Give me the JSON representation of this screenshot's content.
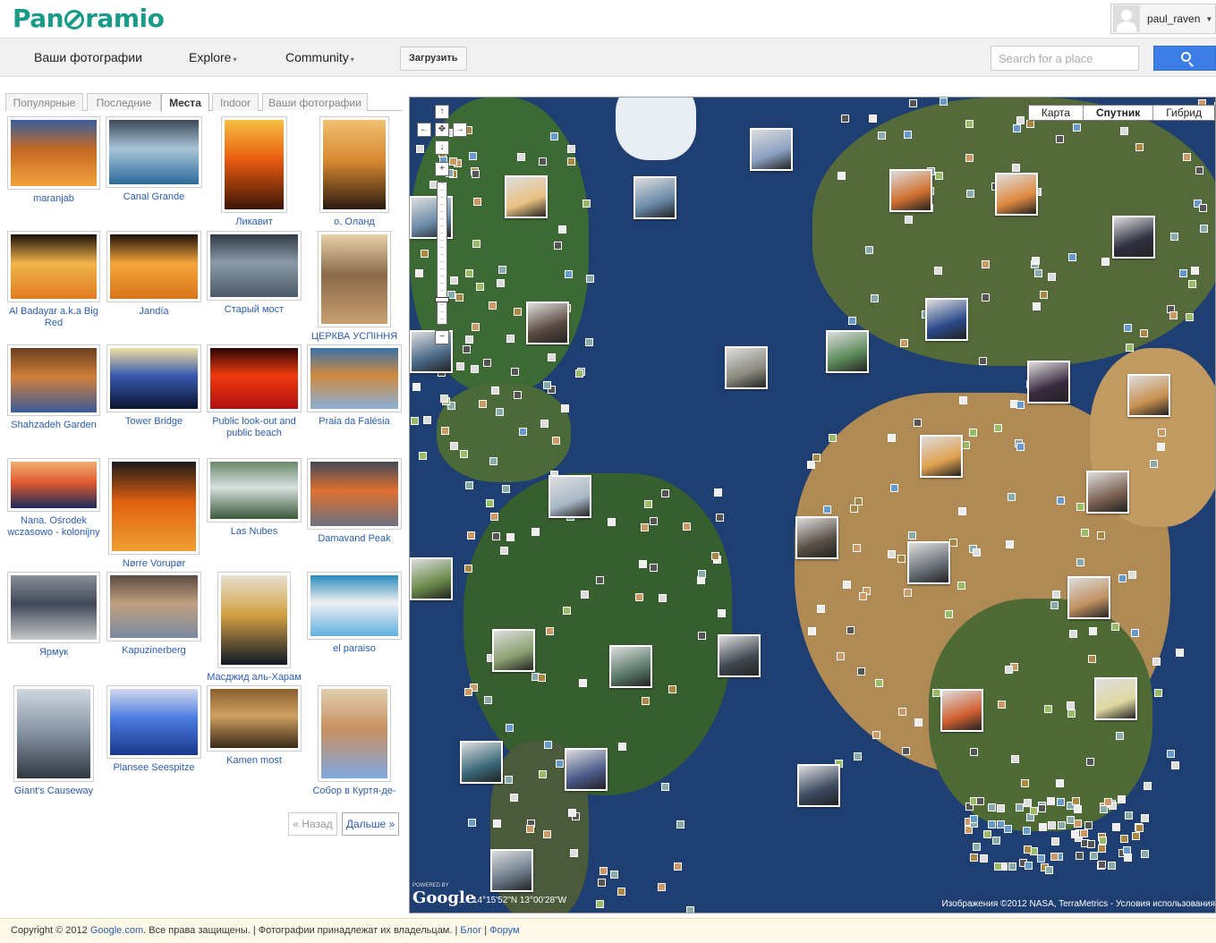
{
  "app": {
    "logo_text": "Panoramio"
  },
  "user": {
    "name": "paul_raven"
  },
  "nav": {
    "my_photos": "Ваши фотографии",
    "explore": "Explore",
    "community": "Community",
    "upload": "Загрузить",
    "search_placeholder": "Search for a place"
  },
  "tabs": [
    "Популярные",
    "Последние",
    "Места",
    "Indoor",
    "Ваши фотографии"
  ],
  "active_tab": "Места",
  "photos": [
    {
      "label": "maranjab",
      "colors": [
        "#f2a23c",
        "#c46a21",
        "#3a5f9e"
      ]
    },
    {
      "label": "Canal Grande",
      "colors": [
        "#2a6a9a",
        "#a8c5d8",
        "#3b4a5a"
      ]
    },
    {
      "label": "Ликавит",
      "colors": [
        "#3b1505",
        "#e85a10",
        "#f7c040"
      ]
    },
    {
      "label": "о. Оланд",
      "colors": [
        "#2a1a10",
        "#d98a30",
        "#f0c070"
      ]
    },
    {
      "label": "Al Badayar a.k.a Big Red",
      "colors": [
        "#e07b22",
        "#f2b44a",
        "#1a1008"
      ]
    },
    {
      "label": "Jandía",
      "colors": [
        "#d8741a",
        "#f5a63a",
        "#1c100a"
      ]
    },
    {
      "label": "Старый мост",
      "colors": [
        "#4a5a68",
        "#8b9aa8",
        "#2e3a44"
      ]
    },
    {
      "label": "ЦЕРКВА УСПІННЯ",
      "colors": [
        "#c8a070",
        "#8a6a48",
        "#e8d0a8"
      ]
    },
    {
      "label": "Shahzadeh Garden",
      "colors": [
        "#3a5a9a",
        "#d0803a",
        "#6a4020"
      ]
    },
    {
      "label": "Tower Bridge",
      "colors": [
        "#0a1430",
        "#3a5ab0",
        "#f0e0a0"
      ]
    },
    {
      "label": "Public look-out and public beach",
      "colors": [
        "#b01010",
        "#f03a10",
        "#2a0505"
      ]
    },
    {
      "label": "Praia da Falésia",
      "colors": [
        "#8ab0d8",
        "#d08a40",
        "#3a70a8"
      ]
    },
    {
      "label": "Nana. Ośrodek wczasowo - kolonijny",
      "colors": [
        "#1a2a5a",
        "#e05a30",
        "#f0b070"
      ]
    },
    {
      "label": "Nørre Vorupør",
      "colors": [
        "#f0a030",
        "#e06010",
        "#1a1a1a"
      ]
    },
    {
      "label": "Las Nubes",
      "colors": [
        "#3a5a3a",
        "#d8e0e0",
        "#6a8a6a"
      ]
    },
    {
      "label": "Damavand Peak",
      "colors": [
        "#6a7080",
        "#e07030",
        "#404858"
      ]
    },
    {
      "label": "Ярмук",
      "colors": [
        "#c8c8c8",
        "#404858",
        "#8a9098"
      ]
    },
    {
      "label": "Kapuzinerberg",
      "colors": [
        "#7a8aa0",
        "#c0a080",
        "#5a4a40"
      ]
    },
    {
      "label": "Масджид аль-Харам",
      "colors": [
        "#101828",
        "#d0a040",
        "#e8e0d0"
      ]
    },
    {
      "label": "el paraiso",
      "colors": [
        "#60b0e0",
        "#f0f0f0",
        "#2a8ac0"
      ]
    },
    {
      "label": "Giant's Causeway",
      "colors": [
        "#303840",
        "#8a98a8",
        "#d0d8e0"
      ]
    },
    {
      "label": "Plansee Seespitze",
      "colors": [
        "#1a3a8a",
        "#4a7ae0",
        "#d0d8f0"
      ]
    },
    {
      "label": "Kamen most",
      "colors": [
        "#3a2a18",
        "#d0a060",
        "#8a6030"
      ]
    },
    {
      "label": "Собор в Куртя-де-",
      "colors": [
        "#80a8e0",
        "#c89060",
        "#e0d0b0"
      ]
    }
  ],
  "pager": {
    "prev": "« Назад",
    "next": "Дальше »"
  },
  "map": {
    "types": [
      "Карта",
      "Спутник",
      "Гибрид"
    ],
    "active_type": "Спутник",
    "powered_by": "POWERED BY",
    "google": "Google",
    "coordinates": "14°15'52\"N 13°00'28\"W",
    "attribution": "Изображения ©2012 NASA, TerraMetrics - Условия использования",
    "colors": {
      "ocean": "#1f3f72",
      "land_green": "#3d6a34",
      "land_desert": "#b08a55",
      "ice": "#e8eef2"
    }
  },
  "footer": {
    "copyright": "Copyright © 2012",
    "google_link": "Google.com",
    "rights": ". Все права защищены. | Фотографии принадлежат их владельцам. |",
    "blog": "Блог",
    "sep": "|",
    "forum": "Форум"
  }
}
